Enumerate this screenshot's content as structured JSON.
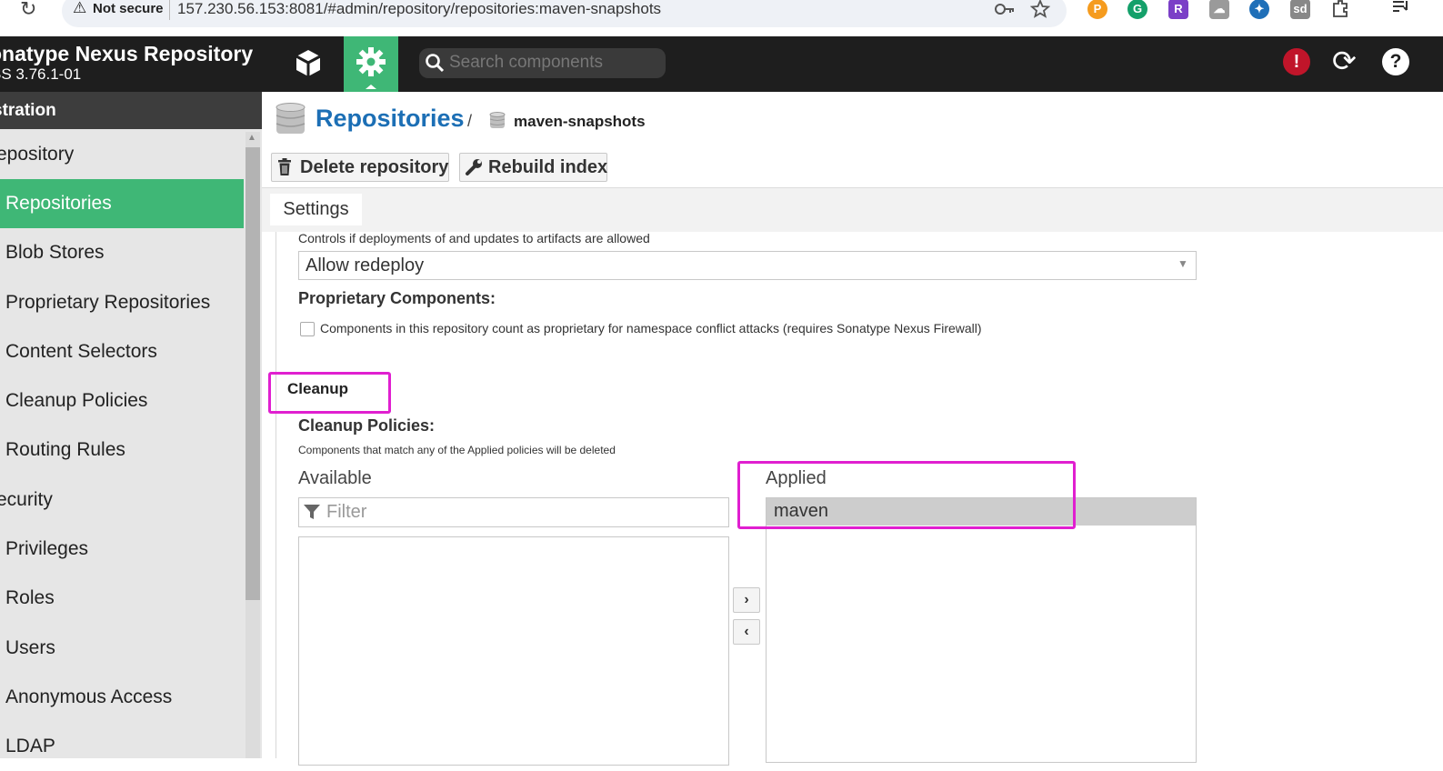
{
  "browser": {
    "not_secure_label": "Not secure",
    "url": "157.230.56.153:8081/#admin/repository/repositories:maven-snapshots"
  },
  "header": {
    "title": "onatype Nexus Repository",
    "version": "SS 3.76.1-01",
    "search_placeholder": "Search components"
  },
  "sidebar": {
    "section_title": "stration",
    "items": [
      {
        "label": "epository",
        "indent": false,
        "active": false
      },
      {
        "label": "Repositories",
        "indent": true,
        "active": true
      },
      {
        "label": "Blob Stores",
        "indent": true,
        "active": false
      },
      {
        "label": "Proprietary Repositories",
        "indent": true,
        "active": false
      },
      {
        "label": "Content Selectors",
        "indent": true,
        "active": false
      },
      {
        "label": "Cleanup Policies",
        "indent": true,
        "active": false
      },
      {
        "label": "Routing Rules",
        "indent": true,
        "active": false
      },
      {
        "label": "ecurity",
        "indent": false,
        "active": false
      },
      {
        "label": "Privileges",
        "indent": true,
        "active": false
      },
      {
        "label": "Roles",
        "indent": true,
        "active": false
      },
      {
        "label": "Users",
        "indent": true,
        "active": false
      },
      {
        "label": "Anonymous Access",
        "indent": true,
        "active": false
      },
      {
        "label": "LDAP",
        "indent": true,
        "active": false
      }
    ]
  },
  "breadcrumb": {
    "root": "Repositories",
    "separator": "/",
    "current": "maven-snapshots"
  },
  "toolbar": {
    "delete_label": "Delete repository",
    "rebuild_label": "Rebuild index"
  },
  "tabs": {
    "settings": "Settings"
  },
  "form": {
    "deployment_help": "Controls if deployments of and updates to artifacts are allowed",
    "deployment_value": "Allow redeploy",
    "proprietary_label": "Proprietary Components:",
    "proprietary_checkbox_text": "Components in this repository count as proprietary for namespace conflict attacks (requires Sonatype Nexus Firewall)",
    "proprietary_checked": false,
    "cleanup_section": "Cleanup",
    "cleanup_policies_label": "Cleanup Policies:",
    "cleanup_help": "Components that match any of the Applied policies will be deleted",
    "available_label": "Available",
    "applied_label": "Applied",
    "filter_placeholder": "Filter",
    "available_items": [],
    "applied_items": [
      "maven"
    ],
    "move_right": "›",
    "move_left": "‹"
  },
  "colors": {
    "accent_green": "#3fb776",
    "link_blue": "#1c6fb5",
    "highlight_magenta": "#e01fd0",
    "alert_red": "#c0152a"
  }
}
